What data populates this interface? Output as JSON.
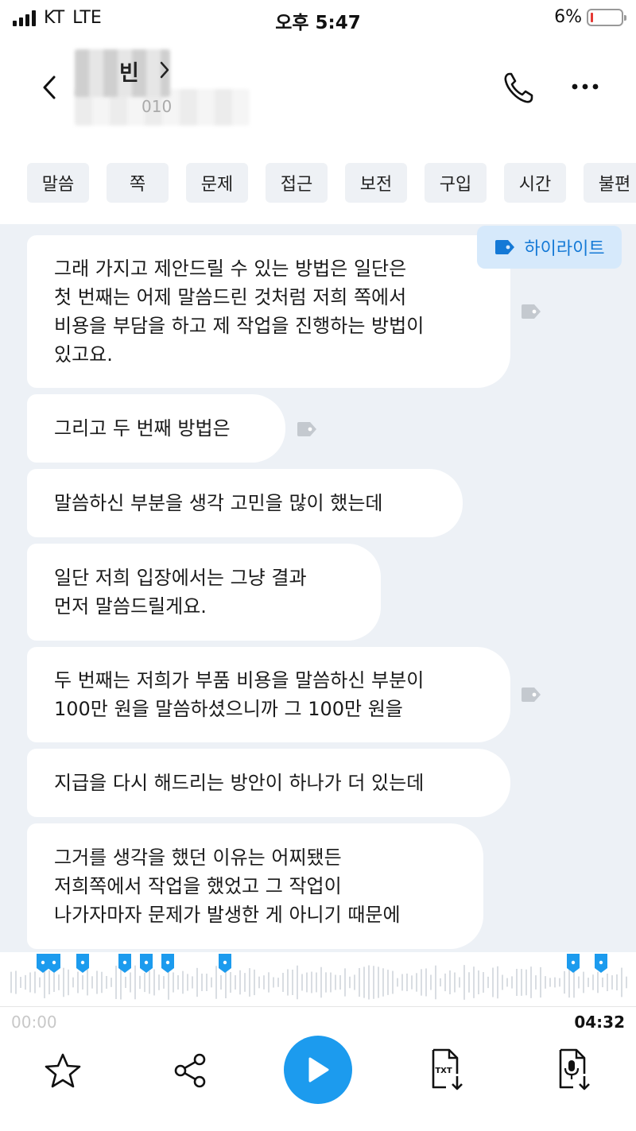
{
  "status_bar": {
    "carrier": "KT",
    "network": "LTE",
    "time": "오후 5:47",
    "battery": "6%",
    "battery_color": "#e53935"
  },
  "header": {
    "contact_name": "빈",
    "contact_sub": "010"
  },
  "keywords": [
    "말씀",
    "쪽",
    "문제",
    "접근",
    "보전",
    "구입",
    "시간",
    "불편"
  ],
  "highlight_label": "하이라이트",
  "messages": [
    {
      "text": "그래 가지고 제안드릴 수 있는 방법은 일단은\n첫 번째는 어제 말씀드린 것처럼 저희 쪽에서\n비용을 부담을 하고 제 작업을 진행하는 방법이\n있고요.",
      "tagged": true
    },
    {
      "text": "그리고 두 번째 방법은",
      "tagged": true
    },
    {
      "text": "말씀하신 부분을 생각 고민을 많이 했는데",
      "tagged": false
    },
    {
      "text": "일단 저희 입장에서는 그냥 결과\n먼저 말씀드릴게요.",
      "tagged": false
    },
    {
      "text": "두 번째는 저희가 부품 비용을 말씀하신 부분이\n100만 원을 말씀하셨으니까 그 100만 원을",
      "tagged": true
    },
    {
      "text": "지급을 다시 해드리는 방안이 하나가 더 있는데",
      "tagged": false
    },
    {
      "text": "그거를 생각을 했던 이유는 어찌됐든\n저희쪽에서 작업을 했었고 그 작업이\n나가자마자 문제가 발생한 게 아니기 때문에",
      "tagged": false
    }
  ],
  "player": {
    "elapsed": "00:00",
    "duration": "04:32",
    "progress": 0
  },
  "colors": {
    "accent": "#1c9bee",
    "chip_bg": "#eef1f5",
    "transcript_bg": "#edf1f6"
  }
}
